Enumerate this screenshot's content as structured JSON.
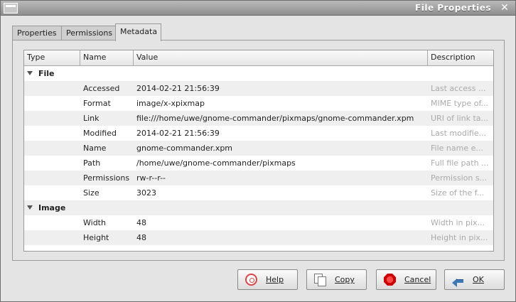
{
  "window": {
    "title": "File Properties"
  },
  "tabs": [
    {
      "label": "Properties"
    },
    {
      "label": "Permissions"
    },
    {
      "label": "Metadata"
    }
  ],
  "table": {
    "columns": [
      "Type",
      "Name",
      "Value",
      "Description"
    ],
    "groups": [
      {
        "label": "File",
        "rows": [
          {
            "name": "Accessed",
            "value": "2014-02-21 21:56:39",
            "description": "Last access ..."
          },
          {
            "name": "Format",
            "value": "image/x-xpixmap",
            "description": "MIME type of..."
          },
          {
            "name": "Link",
            "value": "file:///home/uwe/gnome-commander/pixmaps/gnome-commander.xpm",
            "description": "URI of link ta..."
          },
          {
            "name": "Modified",
            "value": "2014-02-21 21:56:39",
            "description": "Last modifie..."
          },
          {
            "name": "Name",
            "value": "gnome-commander.xpm",
            "description": "File name e..."
          },
          {
            "name": "Path",
            "value": "/home/uwe/gnome-commander/pixmaps",
            "description": "Full file path ..."
          },
          {
            "name": "Permissions",
            "value": "rw-r--r--",
            "description": "Permission s..."
          },
          {
            "name": "Size",
            "value": "3023",
            "description": "Size of the f..."
          }
        ]
      },
      {
        "label": "Image",
        "rows": [
          {
            "name": "Width",
            "value": "48",
            "description": "Width in pix..."
          },
          {
            "name": "Height",
            "value": "48",
            "description": "Height in pix..."
          }
        ]
      }
    ]
  },
  "buttons": {
    "help": "Help",
    "copy": "Copy",
    "cancel": "Cancel",
    "ok": "OK"
  },
  "icons": {
    "window_menu": "window-menu-icon",
    "close": "close-icon",
    "help": "help-icon",
    "copy": "copy-icon",
    "cancel": "cancel-icon",
    "ok": "ok-arrow-icon"
  }
}
